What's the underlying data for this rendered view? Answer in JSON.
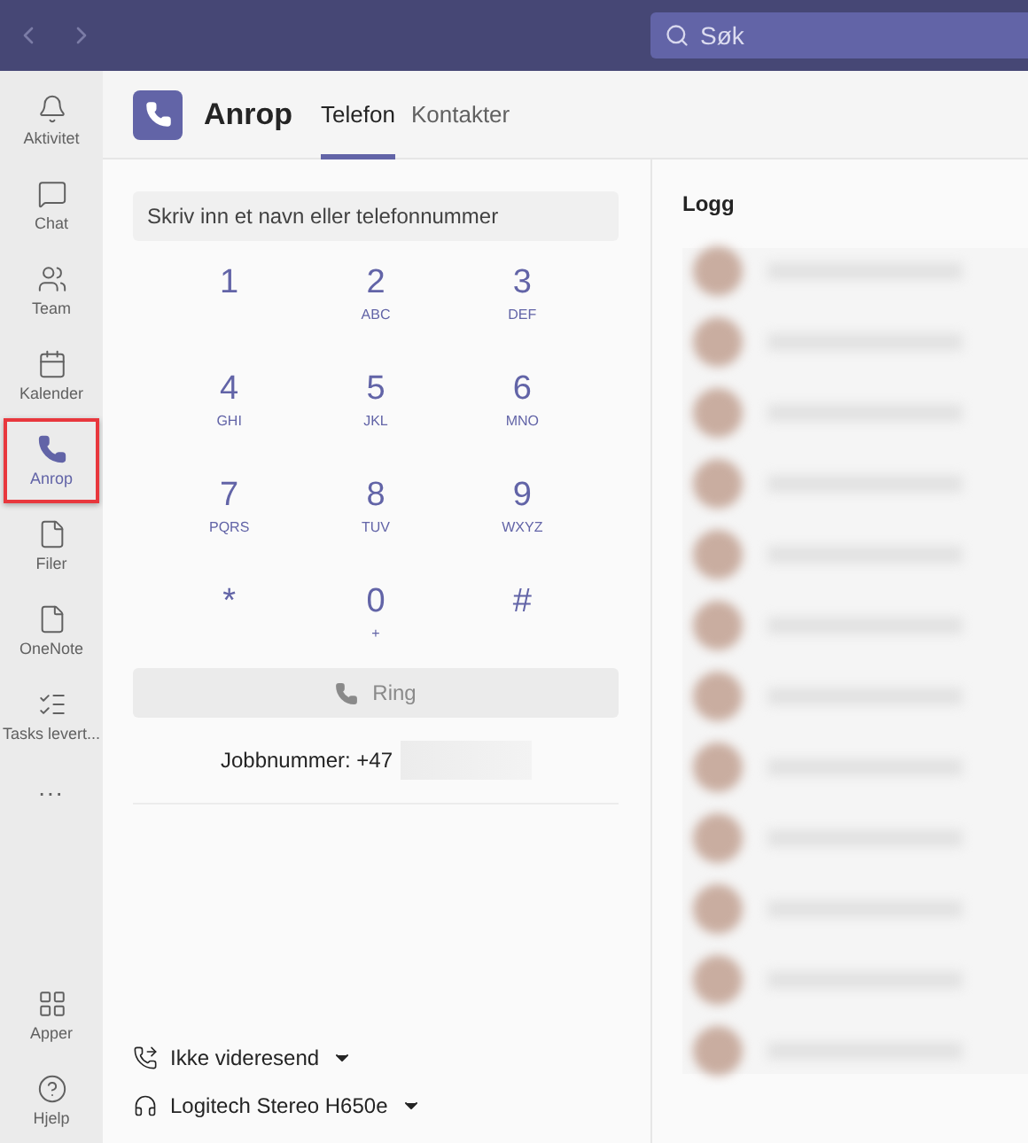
{
  "top_bar": {
    "search": {
      "placeholder": "Søk"
    }
  },
  "sidebar": {
    "items": [
      {
        "label": "Aktivitet",
        "selected": false
      },
      {
        "label": "Chat",
        "selected": false
      },
      {
        "label": "Team",
        "selected": false
      },
      {
        "label": "Kalender",
        "selected": false
      },
      {
        "label": "Anrop",
        "selected": true
      },
      {
        "label": "Filer",
        "selected": false
      },
      {
        "label": "OneNote",
        "selected": false
      },
      {
        "label": "Tasks levert...",
        "selected": false
      }
    ],
    "more": "...",
    "bottom_items": [
      {
        "label": "Apper",
        "selected": false
      },
      {
        "label": "Hjelp",
        "selected": false
      }
    ]
  },
  "header": {
    "title": "Anrop",
    "tabs": [
      {
        "label": "Telefon",
        "selected": true
      },
      {
        "label": "Kontakter",
        "selected": false
      }
    ]
  },
  "dialer": {
    "input": {
      "placeholder": "Skriv inn et navn eller telefonnummer"
    },
    "keys": [
      {
        "digit": "1"
      },
      {
        "digit": "2",
        "letters": "ABC"
      },
      {
        "digit": "3",
        "letters": "DEF"
      },
      {
        "digit": "4",
        "letters": "GHI"
      },
      {
        "digit": "5",
        "letters": "JKL"
      },
      {
        "digit": "6",
        "letters": "MNO"
      },
      {
        "digit": "7",
        "letters": "PQRS"
      },
      {
        "digit": "8",
        "letters": "TUV"
      },
      {
        "digit": "9",
        "letters": "WXYZ"
      },
      {
        "digit": "*"
      },
      {
        "digit": "0",
        "letters": "+"
      },
      {
        "digit": "#"
      }
    ],
    "call_button": {
      "label": "Ring",
      "disabled": true
    },
    "work_number": "Jobbnummer: +47",
    "forwarding": "Ikke videresend",
    "device": "Logitech Stereo H650e"
  },
  "log": {
    "title": "Logg"
  }
}
